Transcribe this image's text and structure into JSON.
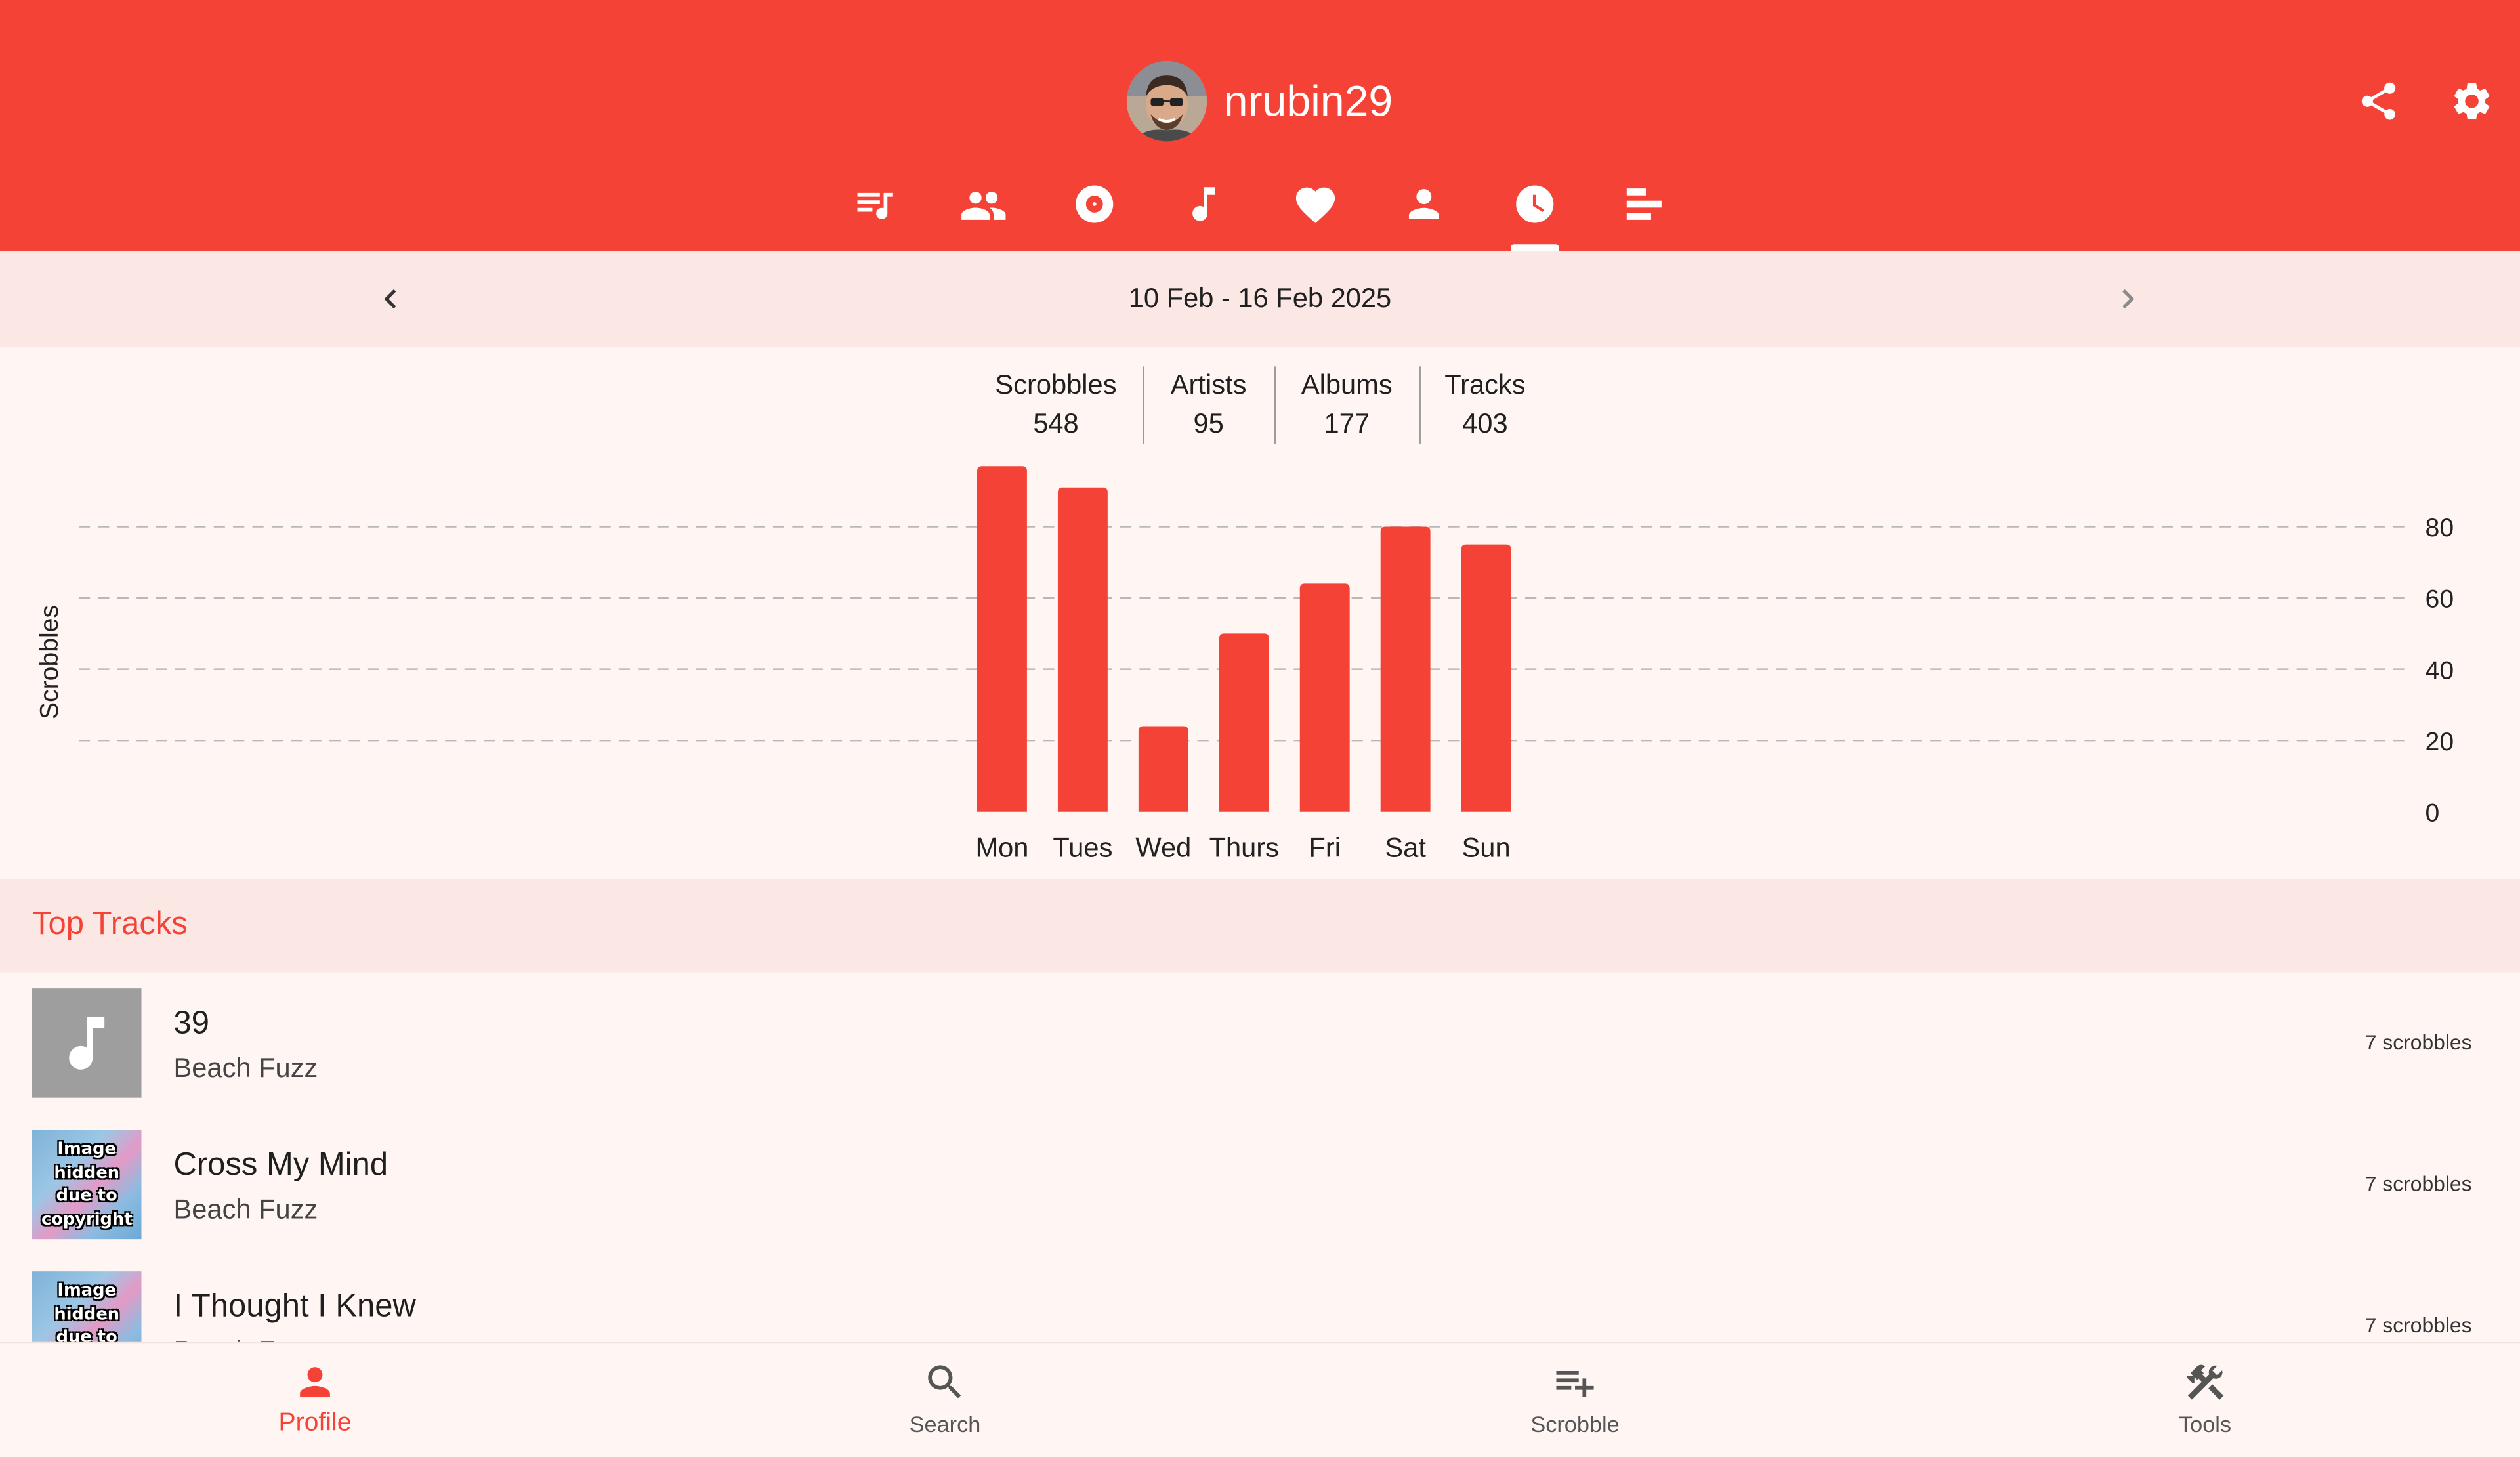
{
  "profile": {
    "username": "nrubin29"
  },
  "header_actions": [
    {
      "icon": "share-icon"
    },
    {
      "icon": "settings-gear-icon"
    }
  ],
  "tabs": [
    {
      "icon": "queue-music-icon",
      "active": false
    },
    {
      "icon": "people-icon",
      "active": false
    },
    {
      "icon": "album-disc-icon",
      "active": false
    },
    {
      "icon": "music-note-icon",
      "active": false
    },
    {
      "icon": "heart-icon",
      "active": false
    },
    {
      "icon": "person-icon",
      "active": false
    },
    {
      "icon": "clock-icon",
      "active": true
    },
    {
      "icon": "bar-chart-icon",
      "active": false
    }
  ],
  "period": {
    "label": "10 Feb - 16 Feb 2025"
  },
  "stats": [
    {
      "label": "Scrobbles",
      "value": "548"
    },
    {
      "label": "Artists",
      "value": "95"
    },
    {
      "label": "Albums",
      "value": "177"
    },
    {
      "label": "Tracks",
      "value": "403"
    }
  ],
  "chart_data": {
    "type": "bar",
    "categories": [
      "Mon",
      "Tues",
      "Wed",
      "Thurs",
      "Fri",
      "Sat",
      "Sun"
    ],
    "values": [
      97,
      91,
      24,
      50,
      64,
      80,
      75
    ],
    "ylabel": "Scrobbles",
    "yticks": [
      0,
      20,
      40,
      60,
      80
    ],
    "ylim": [
      0,
      97
    ],
    "grid": "dashed horizontal",
    "bar_color": "#f44336"
  },
  "top_tracks": {
    "title": "Top Tracks",
    "items": [
      {
        "title": "39",
        "artist": "Beach Fuzz",
        "count": "7 scrobbles",
        "art": "placeholder"
      },
      {
        "title": "Cross My Mind",
        "artist": "Beach Fuzz",
        "count": "7 scrobbles",
        "art": "hidden",
        "art_text": "Image hidden due to copyright"
      },
      {
        "title": "I Thought I Knew",
        "artist": "Beach Fuzz",
        "count": "7 scrobbles",
        "art": "hidden",
        "art_text": "Image hidden due to copyright"
      }
    ]
  },
  "bottom_nav": [
    {
      "label": "Profile",
      "icon": "person-icon",
      "active": true
    },
    {
      "label": "Search",
      "icon": "search-icon",
      "active": false
    },
    {
      "label": "Scrobble",
      "icon": "playlist-add-icon",
      "active": false
    },
    {
      "label": "Tools",
      "icon": "tools-icon",
      "active": false
    }
  ],
  "colors": {
    "accent": "#f44336",
    "background": "#fff6f4",
    "section": "#fbe8e4"
  }
}
